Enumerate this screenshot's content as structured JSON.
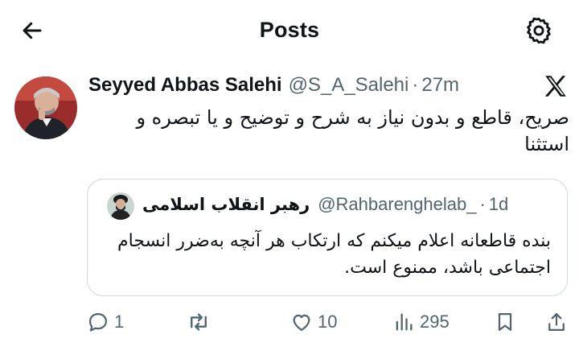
{
  "header": {
    "title": "Posts",
    "back_icon": "arrow-left-icon",
    "settings_icon": "gear-icon"
  },
  "post": {
    "author_name": "Seyyed Abbas Salehi",
    "handle": "@S_A_Salehi",
    "separator": "·",
    "time": "27m",
    "text": "صریح، قاطع و بدون نیاز به شرح و توضیح  و یا تبصره و استثنا",
    "platform_icon": "x-logo-icon"
  },
  "quote": {
    "author_name": "رهبر انقلاب اسلامی",
    "handle": "@Rahbarenghelab_",
    "separator": "·",
    "time": "1d",
    "text": "بنده قاطعانه اعلام میکنم که ارتکاب هر آنچه به‌ضرر انسجام اجتماعی باشد، ممنوع است."
  },
  "actions": {
    "replies": "1",
    "reposts": "",
    "likes": "10",
    "views": "295"
  },
  "colors": {
    "text_primary": "#0f1419",
    "text_secondary": "#536471",
    "border": "#cfd9de"
  }
}
